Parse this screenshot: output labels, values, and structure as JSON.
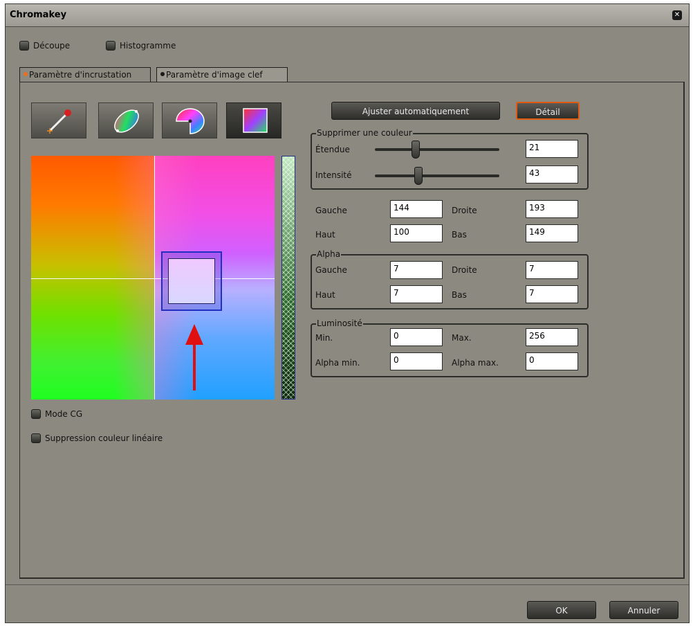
{
  "window": {
    "title": "Chromakey",
    "close_icon": "close-icon"
  },
  "options": {
    "decoupe": "Découpe",
    "histogramme": "Histogramme"
  },
  "tabs": [
    {
      "label": "Paramètre d'incrustation",
      "dot_color": "#e87020"
    },
    {
      "label": "Paramètre d'image clef",
      "dot_color": "#1a1a1a"
    }
  ],
  "tools": [
    {
      "icon": "eyedropper-icon"
    },
    {
      "icon": "ellipse-gradient-icon"
    },
    {
      "icon": "color-wheel-icon"
    },
    {
      "icon": "square-gradient-icon"
    }
  ],
  "buttons": {
    "auto": "Ajuster automatiquement",
    "detail": "Détail",
    "ok": "OK",
    "cancel": "Annuler"
  },
  "suppress": {
    "legend": "Supprimer une couleur",
    "etendue_label": "Étendue",
    "etendue_value": "21",
    "intensite_label": "Intensité",
    "intensite_value": "43"
  },
  "region": {
    "gauche_label": "Gauche",
    "gauche": "144",
    "droite_label": "Droite",
    "droite": "193",
    "haut_label": "Haut",
    "haut": "100",
    "bas_label": "Bas",
    "bas": "149"
  },
  "alpha": {
    "legend": "Alpha",
    "gauche_label": "Gauche",
    "gauche": "7",
    "droite_label": "Droite",
    "droite": "7",
    "haut_label": "Haut",
    "haut": "7",
    "bas_label": "Bas",
    "bas": "7"
  },
  "luminosite": {
    "legend": "Luminosité",
    "min_label": "Min.",
    "min": "0",
    "max_label": "Max.",
    "max": "256",
    "alpha_min_label": "Alpha min.",
    "alpha_min": "0",
    "alpha_max_label": "Alpha max.",
    "alpha_max": "0"
  },
  "checks": {
    "mode_cg": "Mode CG",
    "suppression_lineaire": "Suppression couleur linéaire"
  },
  "colors": {
    "accent_orange": "#e05a10",
    "selection_blue": "#2030c0",
    "arrow_red": "#e01010"
  }
}
